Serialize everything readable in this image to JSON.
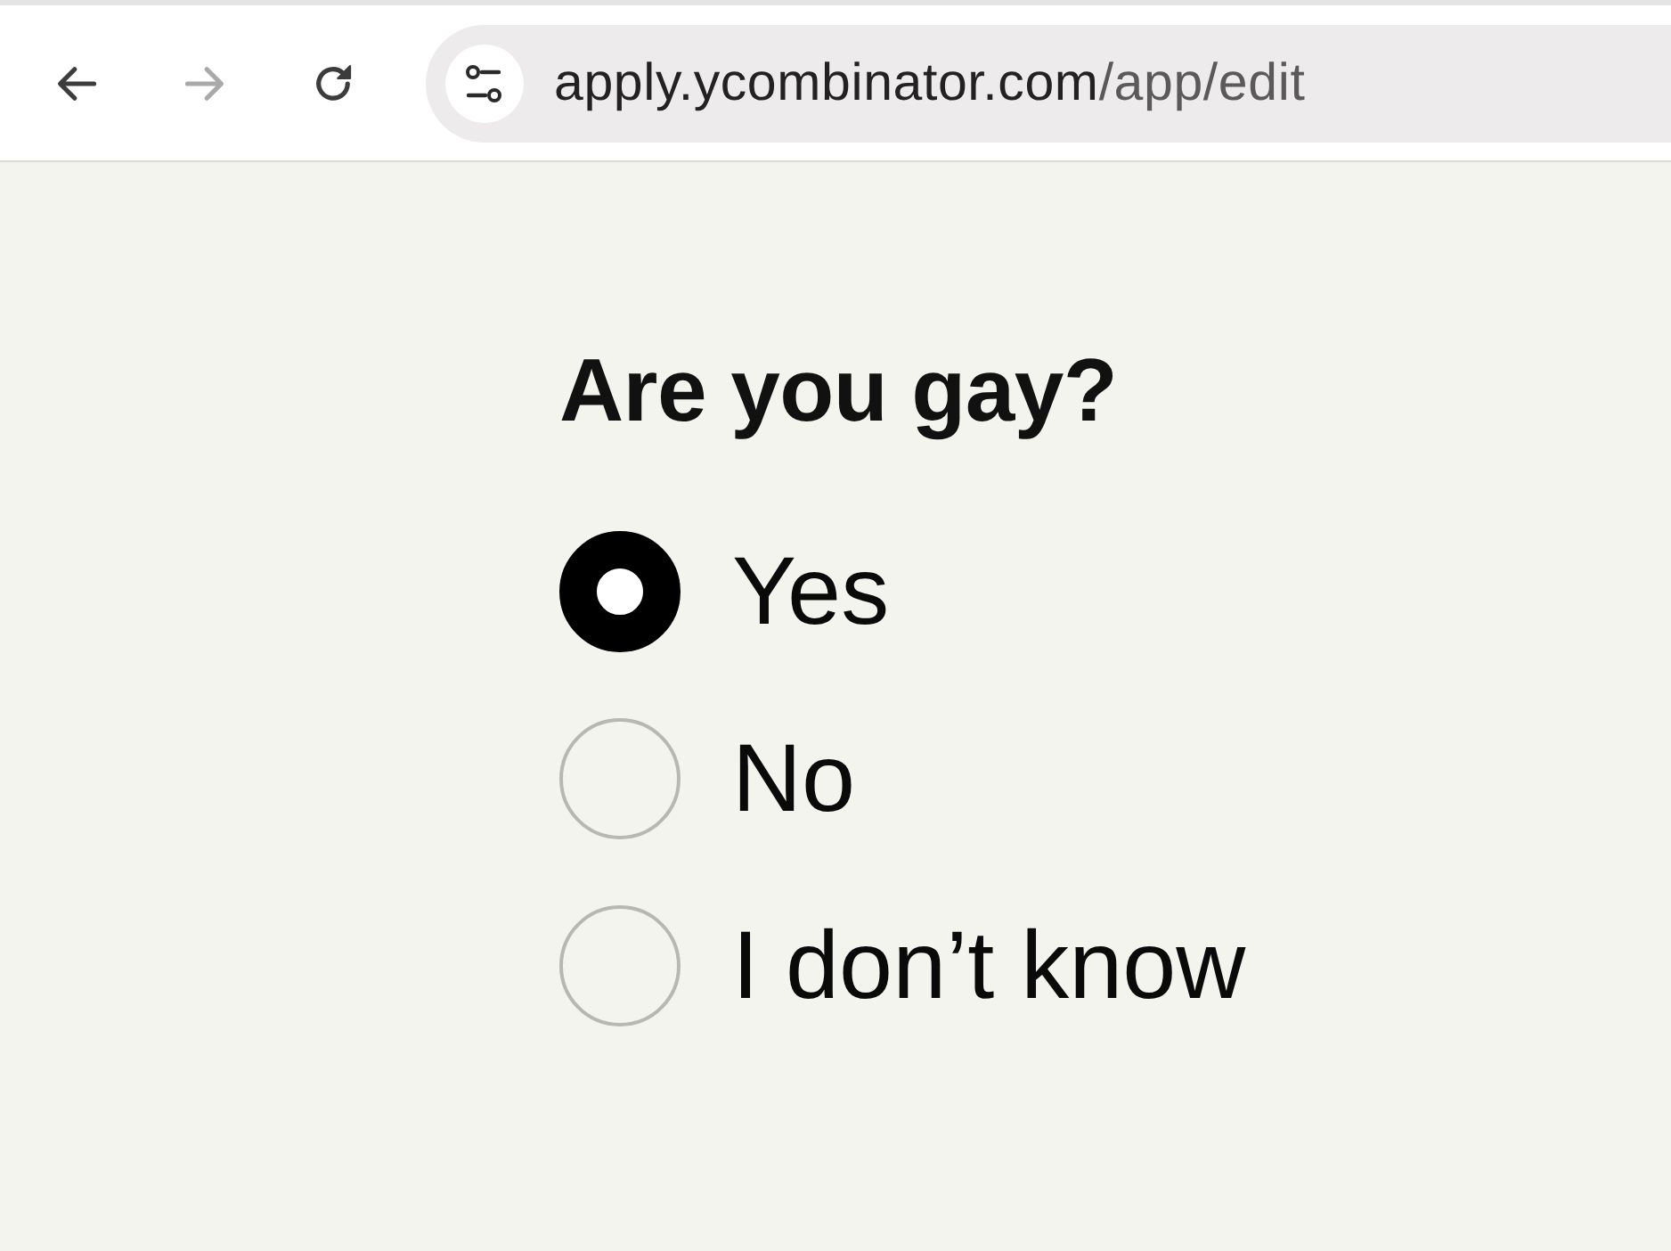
{
  "browser": {
    "nav_buttons": [
      {
        "kind": "back",
        "disabled": false
      },
      {
        "kind": "forward",
        "disabled": true
      },
      {
        "kind": "reload",
        "disabled": false
      }
    ],
    "address_bar": {
      "host": "apply.ycombinator.com",
      "path": "/app/edit"
    }
  },
  "question": {
    "title": "Are you gay?",
    "options": [
      {
        "label": "Yes",
        "selected": true
      },
      {
        "label": "No",
        "selected": false
      },
      {
        "label": "I don’t know",
        "selected": false
      }
    ]
  }
}
